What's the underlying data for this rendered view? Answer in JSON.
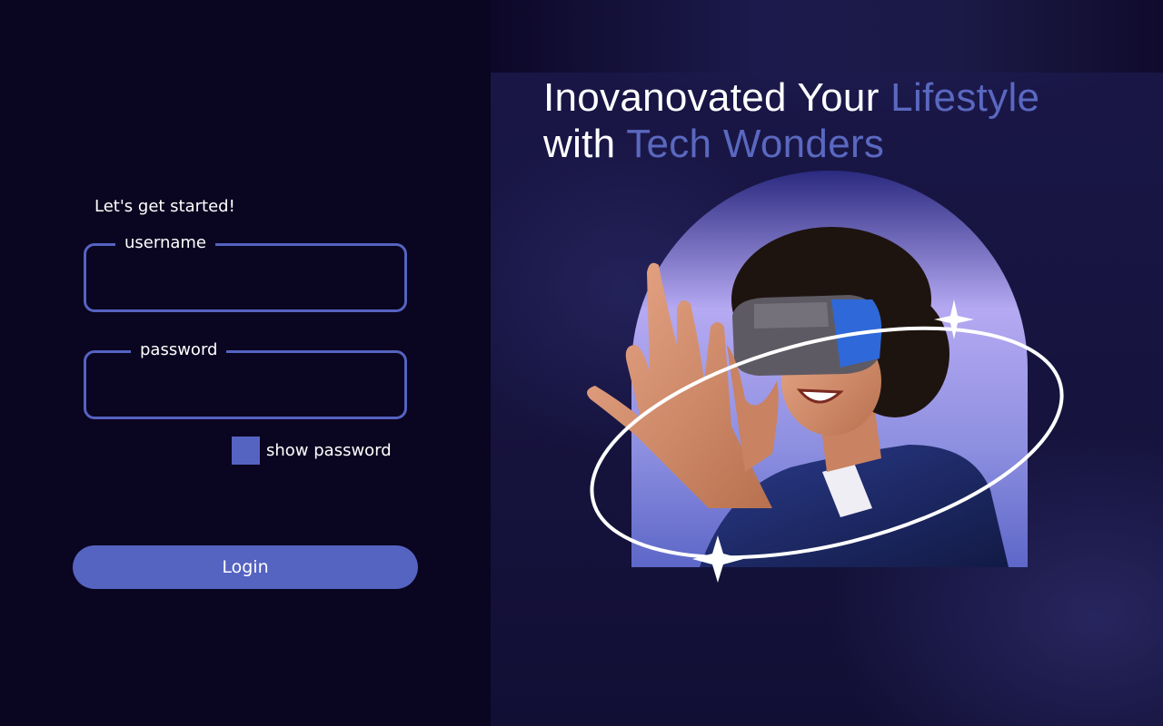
{
  "hero": {
    "headline_line1": "Inovanovated Your ",
    "headline_line1_accent": "Lifestyle",
    "headline_line2": "with ",
    "headline_line2_accent": "Tech Wonders",
    "image_alt": "person-wearing-vr-headset"
  },
  "login_form": {
    "greeting": "Let's get started!",
    "username_label": "username",
    "username_value": "",
    "password_label": "password",
    "password_value": "",
    "show_password_label": "show password",
    "show_password_checked": false,
    "login_button_label": "Login"
  },
  "colors": {
    "accent": "#5563c1",
    "accent_text": "#5a68c0",
    "background_dark": "#0a0520",
    "background_panel": "#1a1748",
    "circle_top": "#2b2a80",
    "circle_mid": "#b5a9f2",
    "circle_bottom": "#5d67c8"
  }
}
